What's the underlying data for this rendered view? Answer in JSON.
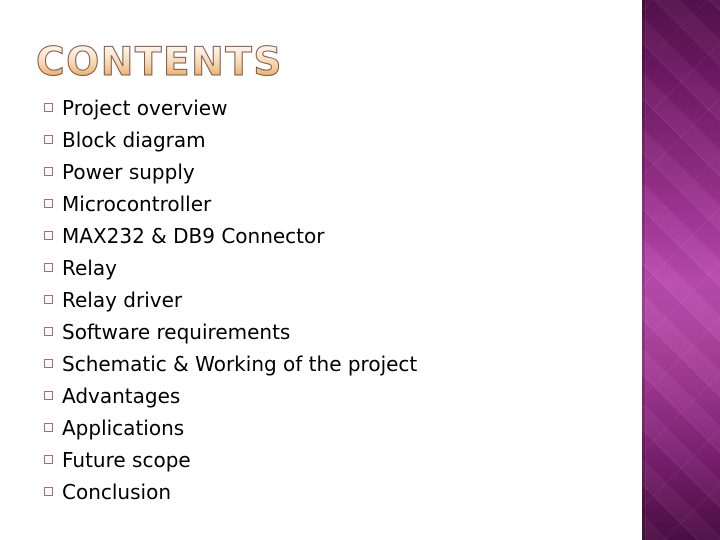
{
  "slide": {
    "title": "CONTENTS",
    "background_color": "#ffffff",
    "text_color": "#000000"
  },
  "decoration": {
    "panel_name": "right-gradient-panel",
    "gradient_top_color": "#55124d",
    "gradient_mid_color": "#b84bad",
    "gradient_bottom_color": "#4c0e44",
    "pattern": "diamond-lattice"
  },
  "title_style": {
    "fill_top_color": "#fffaf2",
    "fill_bottom_color": "#e79a45",
    "outline_color": "#7a5b52"
  },
  "bullets": {
    "glyph": "hollow-square",
    "color": "#9b6a97",
    "items": [
      {
        "label": "Project overview"
      },
      {
        "label": "Block diagram"
      },
      {
        "label": "Power supply"
      },
      {
        "label": "Microcontroller"
      },
      {
        "label": "MAX232 & DB9 Connector"
      },
      {
        "label": "Relay"
      },
      {
        "label": "Relay driver"
      },
      {
        "label": "Software requirements"
      },
      {
        "label": "Schematic & Working of the project"
      },
      {
        "label": "Advantages"
      },
      {
        "label": "Applications"
      },
      {
        "label": "Future scope"
      },
      {
        "label": "Conclusion"
      }
    ]
  }
}
